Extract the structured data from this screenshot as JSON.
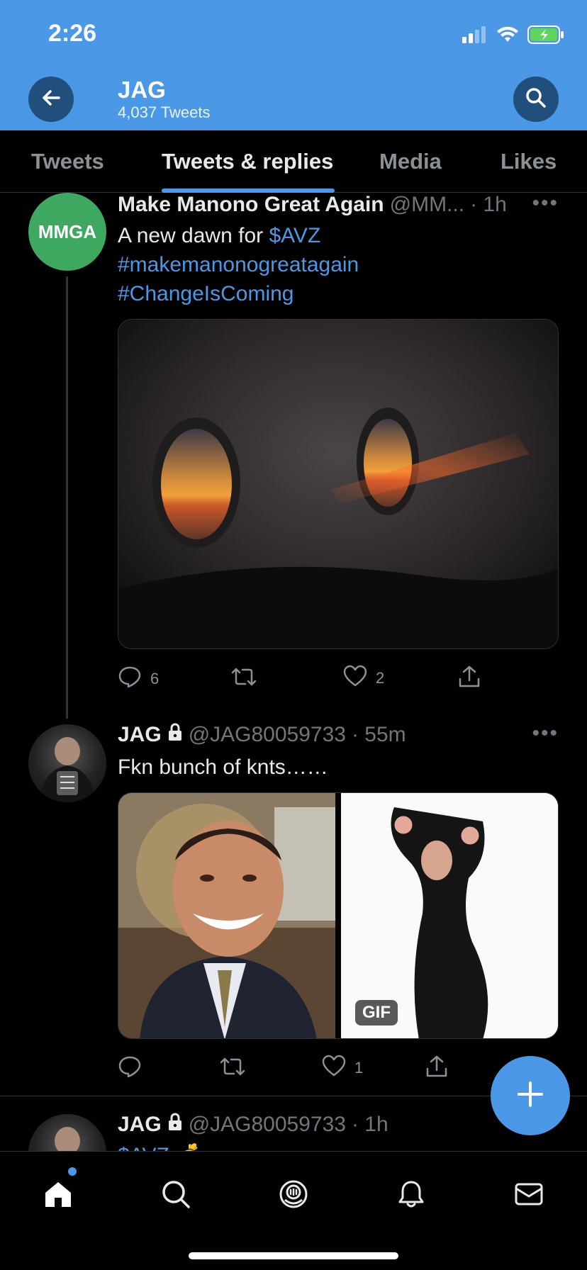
{
  "status": {
    "time": "2:26"
  },
  "header": {
    "title": "JAG",
    "subtitle": "4,037 Tweets"
  },
  "tabs": [
    {
      "label": "Tweets"
    },
    {
      "label": "Tweets & replies",
      "active": true
    },
    {
      "label": "Media"
    },
    {
      "label": "Likes"
    }
  ],
  "tweets": [
    {
      "name": "Make Manono Great Again",
      "handle": "@MM...",
      "time": "· 1h",
      "avatar_text": "MMGA",
      "text_plain": "A new dawn for ",
      "cashtag": "$AVZ",
      "hashtag1": "#makemanonogreatagain",
      "hashtag2": "#ChangeIsComing",
      "replies": "6",
      "retweets": "",
      "likes": "2"
    },
    {
      "name": "JAG",
      "handle": "@JAG80059733",
      "time": "· 55m",
      "text": "Fkn bunch of knts……",
      "gif_badge": "GIF",
      "replies": "",
      "retweets": "",
      "likes": "1"
    },
    {
      "name": "JAG",
      "handle": "@JAG80059733",
      "time": "· 1h",
      "text_partial": "$AVZ 💰"
    }
  ],
  "colors": {
    "accent": "#4b99e6",
    "header_bg": "#4b99e6",
    "muted": "#71767b"
  }
}
